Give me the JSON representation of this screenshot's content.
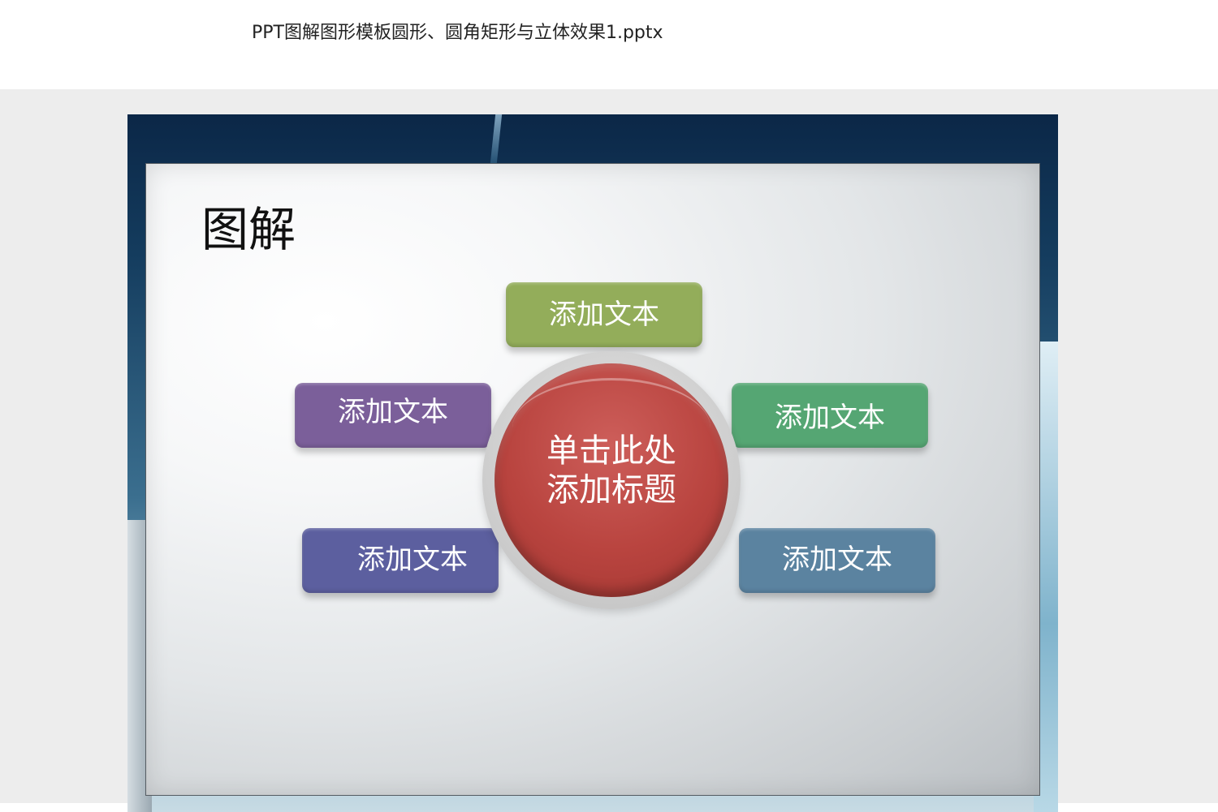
{
  "document": {
    "file_name": "PPT图解图形模板圆形、圆角矩形与立体效果1.pptx"
  },
  "slide": {
    "title": "图解",
    "center": {
      "line1": "单击此处",
      "line2": "添加标题"
    },
    "boxes": {
      "top": "添加文本",
      "left_upper": "添加文本",
      "right_upper": "添加文本",
      "left_lower": "添加文本",
      "right_lower": "添加文本"
    }
  },
  "colors": {
    "box_top": "#93ad5a",
    "box_left_upper": "#7b5f9a",
    "box_right_upper": "#55a673",
    "box_left_lower": "#5c5f9f",
    "box_right_lower": "#5b83a0",
    "center_circle": "#b9443f"
  }
}
